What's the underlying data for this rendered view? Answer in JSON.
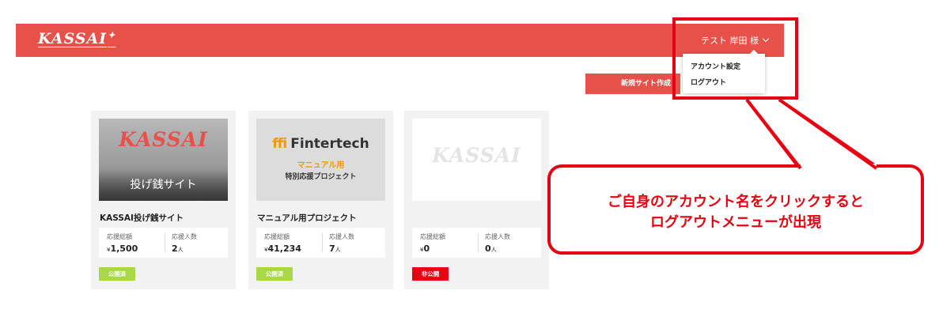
{
  "header": {
    "logo": "KASSAI",
    "user_name": "テスト 岸田 様",
    "accent_color": "#e8504a"
  },
  "dropdown": {
    "items": [
      {
        "label": "アカウント設定"
      },
      {
        "label": "ログアウト"
      }
    ]
  },
  "actions": {
    "new_site_label": "新規サイト作成"
  },
  "cards": [
    {
      "thumb_logo": "KASSAI",
      "thumb_sub": "投げ銭サイト",
      "title": "KASSAI投げ銭サイト",
      "amount_label": "応援総額",
      "amount_currency": "¥",
      "amount_value": "1,500",
      "supporters_label": "応援人数",
      "supporters_value": "2",
      "supporters_unit": "人",
      "status": "公開済",
      "status_color": "#a8d84a"
    },
    {
      "thumb_brand": "Fintertech",
      "thumb_line1": "マニュアル用",
      "thumb_line2": "特別応援プロジェクト",
      "title": "マニュアル用プロジェクト",
      "amount_label": "応援総額",
      "amount_currency": "¥",
      "amount_value": "41,234",
      "supporters_label": "応援人数",
      "supporters_value": "7",
      "supporters_unit": "人",
      "status": "公開済",
      "status_color": "#a8d84a"
    },
    {
      "thumb_logo": "KASSAI",
      "title": "",
      "amount_label": "応援総額",
      "amount_currency": "¥",
      "amount_value": "0",
      "supporters_label": "応援人数",
      "supporters_value": "0",
      "supporters_unit": "人",
      "status": "非公開",
      "status_color": "#e60012"
    }
  ],
  "callout": {
    "line1": "ご自身のアカウント名をクリックすると",
    "line2": "ログアウトメニューが出現",
    "color": "#e60012"
  }
}
